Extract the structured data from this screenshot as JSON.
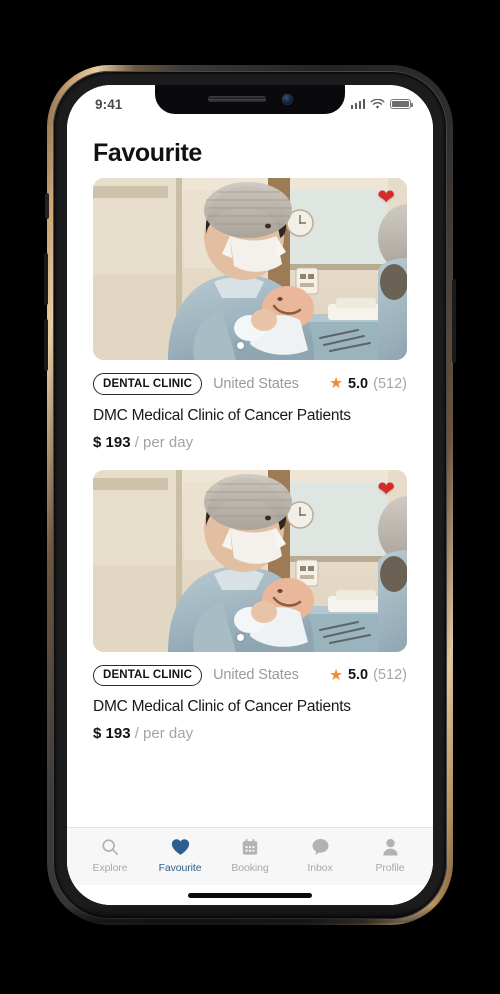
{
  "status_bar": {
    "time": "9:41",
    "signal_icon": "cellular-signal-icon",
    "wifi_icon": "wifi-icon",
    "battery_icon": "battery-icon"
  },
  "header": {
    "title": "Favourite"
  },
  "colors": {
    "accent_blue": "#2C5E8F",
    "star_orange": "#F5892E",
    "heart_red": "#D62B27",
    "text_primary": "#141416",
    "text_muted": "#A3A3A5",
    "tab_bar_bg": "#F7F7F7"
  },
  "cards": [
    {
      "badge": "DENTAL CLINIC",
      "country": "United States",
      "rating": "5.0",
      "review_count": "(512)",
      "name": "DMC Medical Clinic of Cancer Patients",
      "price": "$ 193",
      "price_unit": "/ per day",
      "favourite_icon": "heart-filled-icon",
      "favourited": true,
      "photo_alt": "Surgeon in scrubs and cap holding a newborn baby in an operating room"
    },
    {
      "badge": "DENTAL CLINIC",
      "country": "United States",
      "rating": "5.0",
      "review_count": "(512)",
      "name": "DMC Medical Clinic of Cancer Patients",
      "price": "$ 193",
      "price_unit": "/ per day",
      "favourite_icon": "heart-filled-icon",
      "favourited": true,
      "photo_alt": "Surgeon in scrubs and cap holding a newborn baby in an operating room"
    }
  ],
  "tab_bar": {
    "active": "Favourite",
    "items": [
      {
        "label": "Explore",
        "icon": "search-icon"
      },
      {
        "label": "Favourite",
        "icon": "heart-filled-icon"
      },
      {
        "label": "Booking",
        "icon": "calendar-icon"
      },
      {
        "label": "Inbox",
        "icon": "chat-bubble-icon"
      },
      {
        "label": "Profile",
        "icon": "person-icon"
      }
    ]
  }
}
